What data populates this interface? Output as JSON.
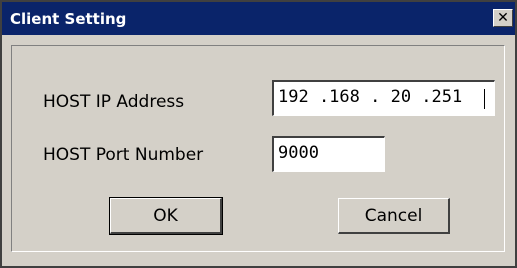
{
  "window": {
    "title": "Client Setting",
    "close_label": "✕"
  },
  "form": {
    "host_ip": {
      "label": "HOST IP Address",
      "value": "192 .168 . 20 .251"
    },
    "host_port": {
      "label": "HOST Port Number",
      "value": "9000"
    }
  },
  "buttons": {
    "ok_label": "OK",
    "cancel_label": "Cancel"
  },
  "colors": {
    "titlebar": "#0a246a",
    "dialog_face": "#d4d0c8"
  }
}
